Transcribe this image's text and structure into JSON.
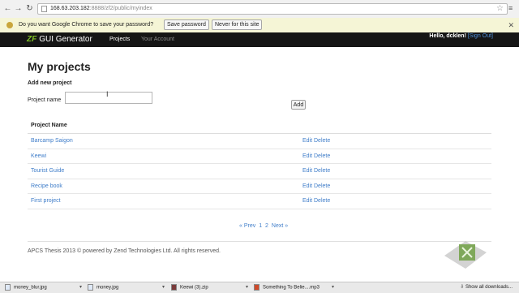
{
  "browser": {
    "url_host": "168.63.203.182",
    "url_path": ":8888/zf2/public/myindex"
  },
  "password_bar": {
    "message": "Do you want Google Chrome to save your password?",
    "save_label": "Save password",
    "never_label": "Never for this site"
  },
  "app": {
    "logo_mark": "ZF",
    "logo_text": "GUI Generator",
    "nav": [
      "Projects",
      "Your Account"
    ],
    "greeting": "Hello, dcklen!",
    "signout": "[Sign Out]"
  },
  "page": {
    "title": "My projects",
    "add_heading": "Add new project",
    "project_name_label": "Project name",
    "project_name_value": "",
    "add_button": "Add"
  },
  "table": {
    "header": "Project Name",
    "edit_label": "Edit",
    "delete_label": "Delete",
    "rows": [
      "Barcamp Saigon",
      "Keewi",
      "Tourist Guide",
      "Recipe book",
      "First project"
    ]
  },
  "pagination": {
    "prev": "« Prev",
    "page1": "1",
    "page2": "2",
    "next": "Next »"
  },
  "footer": {
    "text": "APCS Thesis 2013 © powered by Zend Technologies Ltd. All rights reserved."
  },
  "downloads": {
    "items": [
      "money_blur.jpg",
      "money.jpg",
      "Keewi (3).zip",
      "Something To Belie....mp3"
    ],
    "show_all": "Show all downloads..."
  }
}
